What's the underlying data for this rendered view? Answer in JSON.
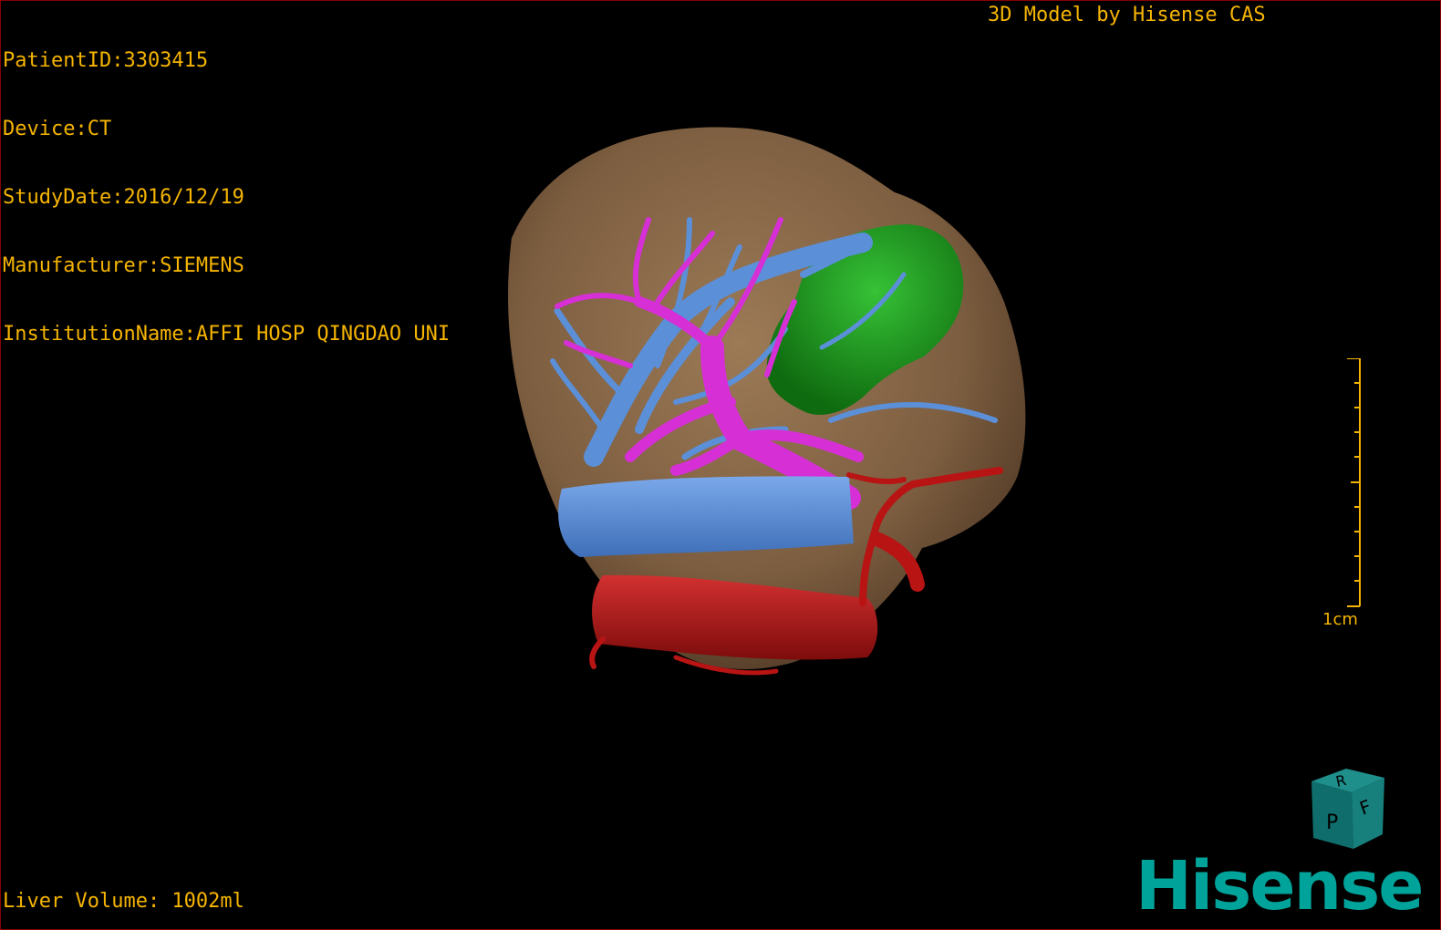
{
  "patient": {
    "id_line": "PatientID:3303415",
    "device_line": "Device:CT",
    "study_date_line": "StudyDate:2016/12/19",
    "manufacturer_line": "Manufacturer:SIEMENS",
    "institution_line": "InstitutionName:AFFI HOSP QINGDAO UNI"
  },
  "credit": "3D Model by Hisense CAS",
  "liver_volume": "Liver Volume: 1002ml",
  "scale_bar": {
    "label": "1cm"
  },
  "orientation_cube": {
    "faces": [
      "R",
      "F",
      "P"
    ]
  },
  "brand": {
    "name": "Hisense",
    "color": "#00a39a"
  },
  "colors": {
    "text": "#f5b400",
    "liver": "#8b6b4a",
    "hepatic_vein": "#5b8fd8",
    "portal_vein": "#d62fd6",
    "tumor": "#1e9e1e",
    "artery": "#b81414",
    "frame": "#8a0000"
  },
  "icons": [
    "orientation-cube-icon",
    "scale-bar-icon",
    "hisense-logo-icon"
  ]
}
